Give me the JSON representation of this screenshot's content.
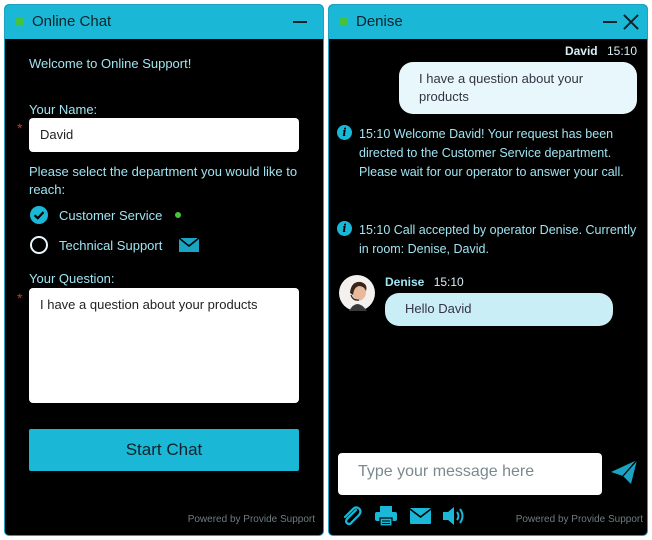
{
  "left": {
    "title": "Online Chat",
    "welcome": "Welcome to Online Support!",
    "name_label": "Your Name:",
    "name_value": "David",
    "dept_label": "Please select the department you would like to reach:",
    "departments": [
      {
        "label": "Customer Service",
        "selected": true,
        "status": "online"
      },
      {
        "label": "Technical Support",
        "selected": false,
        "status": "email"
      }
    ],
    "question_label": "Your Question:",
    "question_value": "I have a question about your products",
    "required_mark": "*",
    "start_button": "Start Chat",
    "powered": "Powered by Provide Support"
  },
  "right": {
    "title": "Denise",
    "messages": [
      {
        "author": "David",
        "time": "15:10",
        "text": "I have a question about your products"
      },
      {
        "system": true,
        "text": "15:10  Welcome David! Your request has been directed to the Customer Service department. Please wait for our operator to answer your call."
      },
      {
        "system": true,
        "text": "15:10  Call accepted by operator Denise. Currently in room: Denise, David."
      },
      {
        "author": "Denise",
        "time": "15:10",
        "text": "Hello David"
      }
    ],
    "input_placeholder": "Type your message here",
    "powered": "Powered by Provide Support",
    "toolbar_icons": [
      "paperclip-icon",
      "printer-icon",
      "envelope-icon",
      "speaker-icon"
    ],
    "send_icon": "send-icon"
  },
  "colors": {
    "accent": "#1ab8d6",
    "online": "#45c33a",
    "text": "#9fe4f2",
    "required": "#e02d2d"
  }
}
